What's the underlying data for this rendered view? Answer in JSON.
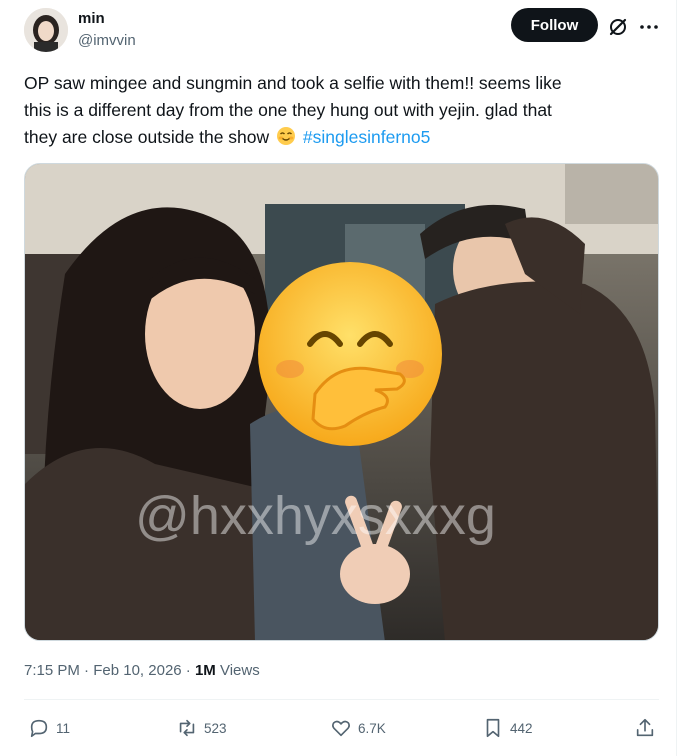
{
  "author": {
    "display_name": "min",
    "handle": "@imvvin",
    "avatar_icon": "user-avatar"
  },
  "header": {
    "follow_label": "Follow",
    "grok_icon": "grok-icon",
    "more_icon": "more-icon"
  },
  "tweet": {
    "line1": "OP saw mingee and sungmin and took a selfie with them!! seems like",
    "line2": "this is a different day from the one they hung out with yejin. glad that",
    "line3": "they are close outside the show",
    "emoji": "smiling-face-with-blush-emoji",
    "hashtag": "#singlesinferno5"
  },
  "media": {
    "watermark": "@hxxhyxsxxxg",
    "overlay_emoji": "face-with-hand-over-mouth-emoji"
  },
  "meta": {
    "time": "7:15 PM",
    "date": "Feb 10, 2026",
    "views_count": "1M",
    "views_label": "Views"
  },
  "actions": {
    "replies": "11",
    "reposts": "523",
    "likes": "6.7K",
    "bookmarks": "442"
  },
  "colors": {
    "accent": "#1d9bf0",
    "text_primary": "#0f1419",
    "text_secondary": "#536471",
    "follow_bg": "#0f1419"
  }
}
